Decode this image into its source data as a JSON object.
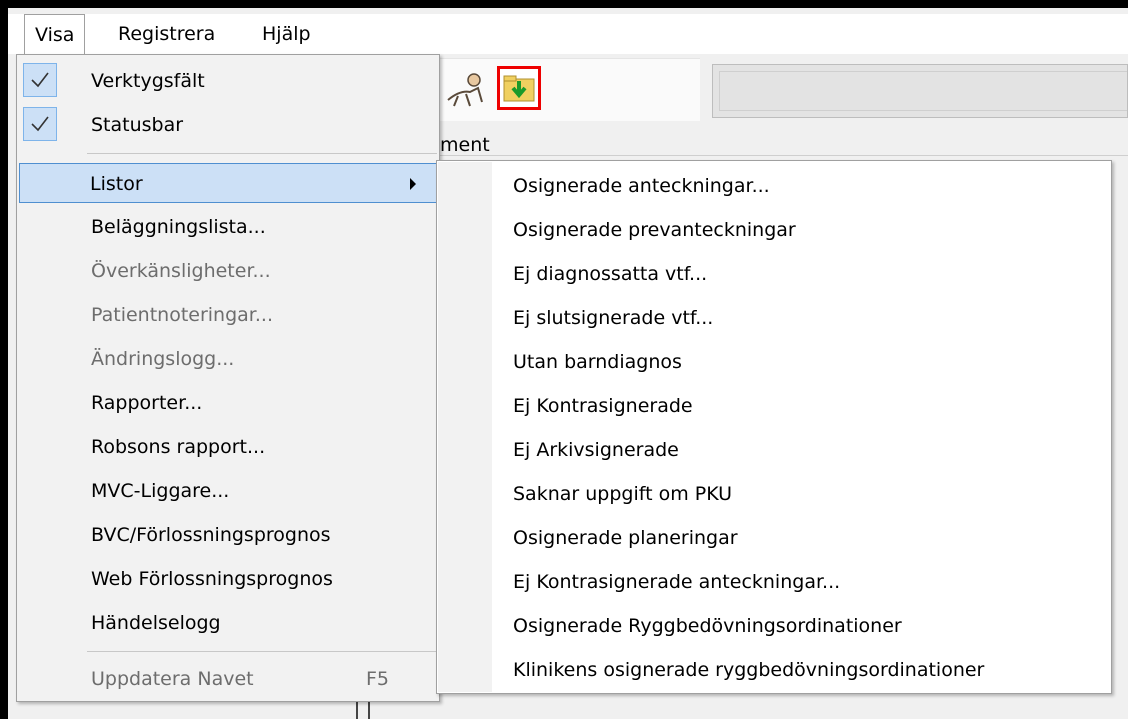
{
  "menubar": {
    "items": [
      {
        "label": "Visa"
      },
      {
        "label": "Registrera"
      },
      {
        "label": "Hjälp"
      }
    ]
  },
  "toolbar": {
    "partial_label": "ment",
    "icons": [
      "user-icon",
      "folder-download-icon"
    ],
    "highlight_color": "#ee0000"
  },
  "visa_menu": {
    "verktygsfalt": {
      "label": "Verktygsfält",
      "checked": true
    },
    "statusbar": {
      "label": "Statusbar",
      "checked": true
    },
    "listor": {
      "label": "Listor"
    },
    "belaggningslista": {
      "label": "Beläggningslista..."
    },
    "overkansligheter": {
      "label": "Överkänsligheter..."
    },
    "patientnoteringar": {
      "label": "Patientnoteringar..."
    },
    "andringslogg": {
      "label": "Ändringslogg..."
    },
    "rapporter": {
      "label": "Rapporter..."
    },
    "robsons": {
      "label": "Robsons rapport..."
    },
    "mvc": {
      "label": "MVC-Liggare..."
    },
    "bvc": {
      "label": "BVC/Förlossningsprognos"
    },
    "web": {
      "label": "Web Förlossningsprognos"
    },
    "handelselogg": {
      "label": "Händelselogg"
    },
    "uppdatera": {
      "label": "Uppdatera Navet",
      "shortcut": "F5"
    }
  },
  "listor_submenu": {
    "items": [
      "Osignerade anteckningar...",
      "Osignerade prevanteckningar",
      "Ej diagnossatta vtf...",
      "Ej slutsignerade vtf...",
      "Utan barndiagnos",
      "Ej Kontrasignerade",
      "Ej Arkivsignerade",
      "Saknar uppgift om PKU",
      "Osignerade planeringar",
      "Ej Kontrasignerade anteckningar...",
      "Osignerade Ryggbedövningsordinationer",
      "Klinikens osignerade ryggbedövningsordinationer"
    ]
  },
  "colors": {
    "highlight_bg": "#cce0f6",
    "highlight_border": "#4f8fd0",
    "disabled_text": "#6d6d6d"
  }
}
